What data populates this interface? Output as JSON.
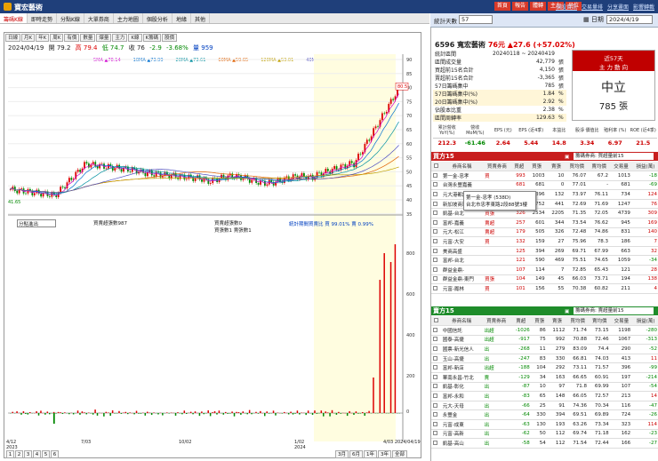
{
  "app": {
    "title": "寶宏藝術",
    "top_buttons": [
      "首頁",
      "報告",
      "體轉",
      "主力",
      "坐位"
    ],
    "top_links": [
      "個股資訊",
      "交易量排",
      "分享畫面",
      "影響轉載"
    ]
  },
  "menu": [
    "籌碼K線",
    "即時走勢",
    "分點K線",
    "大單券商",
    "主力地圖",
    "個股分析",
    "地緣",
    "其他"
  ],
  "right_top": {
    "label": "統計天數",
    "value": "57",
    "date_label": "日期",
    "date_value": "2024/4/19"
  },
  "chart": {
    "toolbar": [
      "日線",
      "月K",
      "年K",
      "周K",
      "有價",
      "數量",
      "爆量",
      "主力",
      "K線",
      "K籌碼",
      "股價"
    ],
    "info": {
      "date": "2024/04/19",
      "open": "開 79.2",
      "high": "高 79.4",
      "low": "低 74.7",
      "close": "收 76",
      "change": "-2.9",
      "pct": "-3.68%",
      "vol": "量 959"
    },
    "ma_legend": [
      "5MA ▲78.14",
      "10MA ▲73.99",
      "20MA ▲73.61",
      "60MA ▲59.65",
      "120MA ▲53.01",
      "40MA ▲64.97"
    ],
    "yticks": [
      "90",
      "85",
      "80",
      "75",
      "70",
      "65",
      "60",
      "55",
      "50",
      "45",
      "40",
      "35"
    ],
    "price_label_hi": "80.5",
    "price_label_lo": "41.65",
    "lower_select": "分點進出",
    "lower_legend1": "買賣超張數987",
    "lower_legend2": "買賣超張數0",
    "lower_legend3": "買張數1 賣張數1",
    "lower_stat": "統計期間買賣比 買 99.01% 賣 0.99%",
    "xticks": [
      "4/12\n2023",
      "7/03",
      "10/02",
      "1/02\n2024",
      "4/03 2024/04/19"
    ],
    "pages": [
      "1",
      "2",
      "3",
      "4",
      "5",
      "6"
    ],
    "ranges": [
      "3月",
      "6月",
      "1年",
      "3年",
      "全部"
    ]
  },
  "stock": {
    "name": "6596 寬宏藝術",
    "price": "76元",
    "chg": "▲27.6 (+57.02%)",
    "stats": [
      [
        "統計區間",
        "20240118 ~ 20240419",
        ""
      ],
      [
        "區間成交量",
        "42,779",
        "張"
      ],
      [
        "買超前15名合計",
        "4,150",
        "張"
      ],
      [
        "賣超前15名合計",
        "-3,365",
        "張"
      ],
      [
        "57日籌碼集中",
        "785",
        "張"
      ],
      [
        "57日籌碼集中(%)",
        "1.84",
        "%"
      ],
      [
        "20日籌碼集中(%)",
        "2.92",
        "%"
      ],
      [
        "佔股本比重",
        "2.38",
        "%"
      ],
      [
        "區間周轉率",
        "129.63",
        "%"
      ]
    ],
    "box": {
      "line1": "近57天",
      "line2": "主 力 動 向",
      "status": "中立",
      "amount": "785 張"
    },
    "fin_head": [
      "累計營收 YoY(%)",
      "營收 MoM(%)",
      "EPS (元)",
      "EPS (近4季)",
      "本益比",
      "股淨 價值比",
      "殖利率 (%)",
      "ROE (近4季)"
    ],
    "fin_vals": [
      "212.3",
      "-61.46",
      "2.64",
      "5.44",
      "14.8",
      "3.34",
      "6.97",
      "21.5"
    ]
  },
  "buy": {
    "title": "買方15",
    "select": "籌碼券商: 買超量前15",
    "cols": [
      "券商名稱",
      "買賣券商",
      "買超",
      "買張",
      "賣張",
      "買均價",
      "賣均價",
      "交易量",
      "損益(萬)"
    ],
    "rows": [
      [
        "第一金-忠孝",
        "買",
        "993",
        "1003",
        "10",
        "76.07",
        "67.2",
        "1013",
        "-18"
      ],
      [
        "台灣永豐嘉義",
        "",
        "681",
        "681",
        "0",
        "77.01",
        "-",
        "681",
        "-69"
      ],
      [
        "元大港都證",
        "",
        "264",
        "396",
        "132",
        "73.97",
        "76.11",
        "734",
        "124"
      ],
      [
        "新加坡商瑞銀",
        "",
        "222",
        "752",
        "441",
        "72.69",
        "71.69",
        "1247",
        "76"
      ],
      [
        "凱基-台北",
        "買張",
        "326",
        "2534",
        "2205",
        "71.35",
        "72.05",
        "4739",
        "309"
      ],
      [
        "富邦-嘉義",
        "賣超",
        "257",
        "601",
        "344",
        "73.54",
        "76.62",
        "945",
        "169"
      ],
      [
        "元大-松江",
        "賣超",
        "179",
        "505",
        "326",
        "72.48",
        "74.86",
        "831",
        "140"
      ],
      [
        "元富-大安",
        "買",
        "132",
        "159",
        "27",
        "75.96",
        "78.3",
        "186",
        "7"
      ],
      [
        "美商高盛",
        "",
        "125",
        "394",
        "269",
        "69.71",
        "67.99",
        "663",
        "32"
      ],
      [
        "富邦-台北",
        "",
        "121",
        "590",
        "469",
        "75.51",
        "74.65",
        "1059",
        "-34"
      ],
      [
        "群益金鼎-",
        "",
        "107",
        "114",
        "7",
        "72.85",
        "65.43",
        "121",
        "28"
      ],
      [
        "群益金鼎-東門",
        "買張",
        "104",
        "149",
        "45",
        "66.03",
        "73.71",
        "194",
        "138"
      ],
      [
        "元富-鳳林",
        "買",
        "101",
        "156",
        "55",
        "70.38",
        "60.82",
        "211",
        "4"
      ]
    ],
    "tooltip_line1": "第一金-忠孝 (538D)",
    "tooltip_line2": "台北市忠孝東路2段88號3樓"
  },
  "sell": {
    "title": "賣方15",
    "select": "籌碼券商: 賣超量前15",
    "cols": [
      "券商名稱",
      "買賣券商",
      "賣超",
      "買張",
      "賣張",
      "買均價",
      "賣均價",
      "交易量",
      "損益(萬)"
    ],
    "rows": [
      [
        "中國信託",
        "出超",
        "-1026",
        "86",
        "1112",
        "71.74",
        "73.15",
        "1198",
        "-280"
      ],
      [
        "國泰-高捷",
        "出超",
        "-917",
        "75",
        "992",
        "70.88",
        "72.46",
        "1067",
        "-313"
      ],
      [
        "國票-新光信人",
        "出",
        "-268",
        "11",
        "279",
        "83.09",
        "74.4",
        "290",
        "-52"
      ],
      [
        "玉山-高捷",
        "出",
        "-247",
        "83",
        "330",
        "66.81",
        "74.03",
        "413",
        "11"
      ],
      [
        "富邦-新店",
        "出超",
        "-188",
        "104",
        "292",
        "73.11",
        "71.57",
        "396",
        "-99"
      ],
      [
        "華南永昌-竹北",
        "賣",
        "-129",
        "34",
        "163",
        "66.65",
        "60.91",
        "197",
        "-214"
      ],
      [
        "凱基-彰化",
        "出",
        "-87",
        "10",
        "97",
        "71.8",
        "69.99",
        "107",
        "-54"
      ],
      [
        "富邦-永和",
        "出",
        "-83",
        "65",
        "148",
        "66.05",
        "72.57",
        "213",
        "14"
      ],
      [
        "元大-天母",
        "出",
        "-66",
        "25",
        "91",
        "74.36",
        "70.34",
        "116",
        "-47"
      ],
      [
        "永豐金",
        "出",
        "-64",
        "330",
        "394",
        "69.51",
        "69.89",
        "724",
        "-26"
      ],
      [
        "元富-成東",
        "出",
        "-63",
        "130",
        "193",
        "63.26",
        "73.34",
        "323",
        "114"
      ],
      [
        "元富-高新",
        "出",
        "-62",
        "50",
        "112",
        "69.74",
        "71.18",
        "162",
        "-23"
      ],
      [
        "凱基-高山",
        "出",
        "-58",
        "54",
        "112",
        "71.54",
        "72.44",
        "166",
        "-27"
      ]
    ]
  }
}
